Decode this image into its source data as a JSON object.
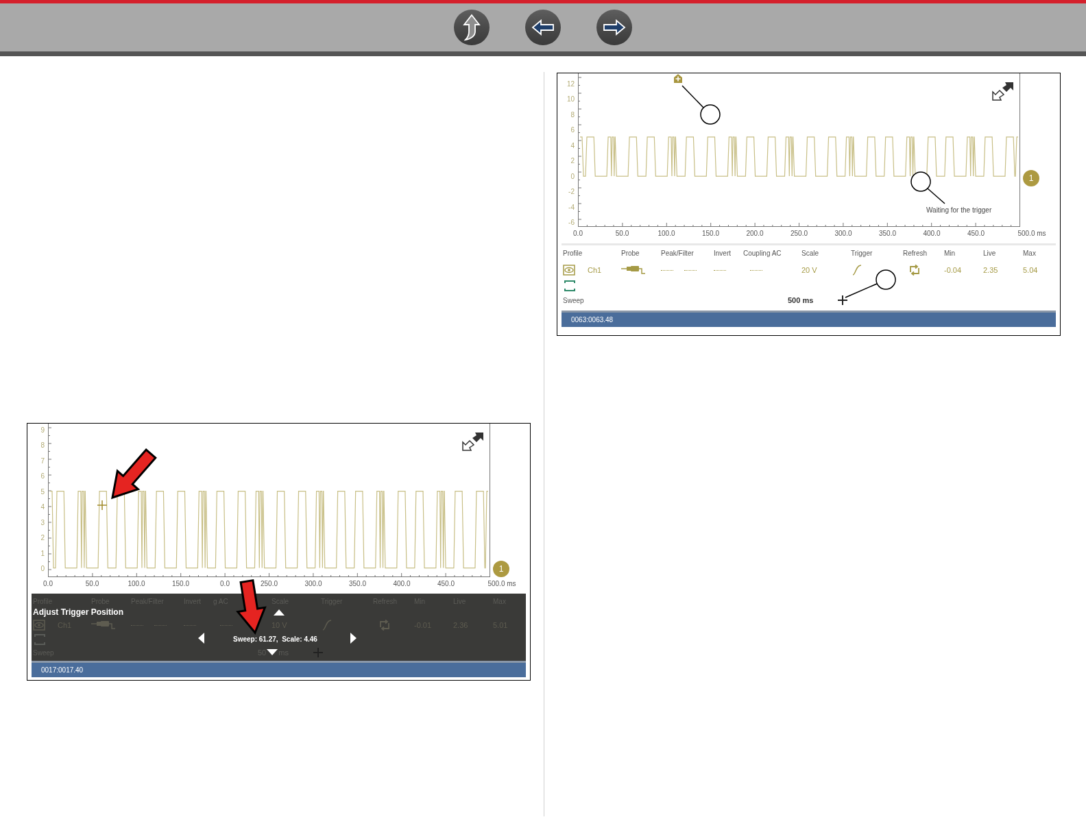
{
  "left_column": {
    "figure": {
      "y_ticks": [
        "9",
        "8",
        "7",
        "6",
        "5",
        "4",
        "3",
        "2",
        "1",
        "0"
      ],
      "x_ticks": [
        "0.0",
        "50.0",
        "100.0",
        "150.0",
        "0.0",
        "250.0",
        "300.0",
        "350.0",
        "400.0",
        "450.0",
        "500.0 ms"
      ],
      "channel_badge": "1",
      "toolbar": {
        "dimmed": true,
        "headers": [
          "Profile",
          "Probe",
          "Peak/Filter",
          "Invert",
          "g AC",
          "Scale",
          "Trigger",
          "Refresh",
          "Min",
          "Live",
          "Max"
        ],
        "channel": "Ch1",
        "scale": "10 V",
        "min": "-0.01",
        "live": "2.36",
        "max": "5.01",
        "sweep_label": "Sweep",
        "sweep_value": [
          "50",
          "ms"
        ]
      },
      "status": "0017:0017.40",
      "overlay": {
        "title": "Adjust Trigger Position",
        "readout": "Sweep: 61.27,  Scale: 4.46"
      }
    }
  },
  "right_column": {
    "figure": {
      "y_ticks": [
        "12",
        "10",
        "8",
        "6",
        "4",
        "2",
        "0",
        "-2",
        "-4",
        "-6"
      ],
      "x_ticks": [
        "0.0",
        "50.0",
        "100.0",
        "150.0",
        "200.0",
        "250.0",
        "300.0",
        "350.0",
        "400.0",
        "450.0",
        "500.0 ms"
      ],
      "channel_badge": "1",
      "trace_note": "Waiting for the trigger",
      "toolbar": {
        "dimmed": false,
        "headers": [
          "Profile",
          "Probe",
          "Peak/Filter",
          "Invert",
          "Coupling AC",
          "Scale",
          "Trigger",
          "Refresh",
          "Min",
          "Live",
          "Max"
        ],
        "channel": "Ch1",
        "scale": "20 V",
        "min": "-0.04",
        "live": "2.35",
        "max": "5.04",
        "sweep_label": "Sweep",
        "sweep_value": [
          "500 ms"
        ]
      },
      "status": "0063:0063.48"
    }
  }
}
